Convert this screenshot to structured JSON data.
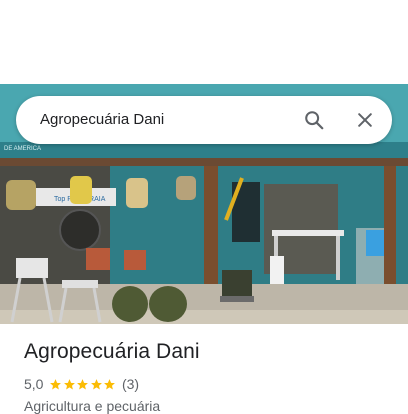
{
  "search": {
    "query": "Agropecuária Dani"
  },
  "photo": {
    "sign_text": "Top Pet ARRAIA"
  },
  "place": {
    "title": "Agropecuária Dani",
    "rating": "5,0",
    "stars_filled": 5,
    "review_count": "(3)",
    "category": "Agricultura e pecuária"
  },
  "colors": {
    "star": "#fbbc04",
    "text_primary": "#202124",
    "text_secondary": "#5f6368"
  }
}
